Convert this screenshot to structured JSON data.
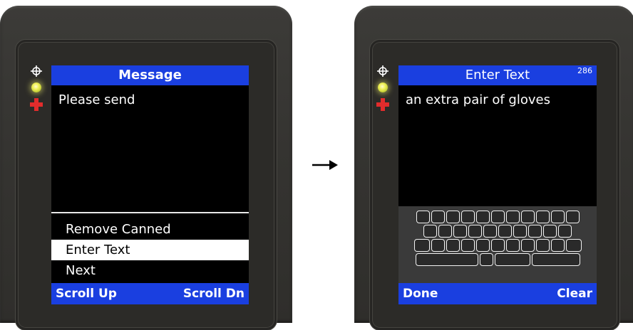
{
  "left_screen": {
    "title": "Message",
    "body_text": "Please send",
    "menu_items": [
      "Remove Canned",
      "Enter Text",
      "Next"
    ],
    "selected_index": 1,
    "softkeys": {
      "left": "Scroll Up",
      "right": "Scroll Dn"
    }
  },
  "right_screen": {
    "title": "Enter Text",
    "char_counter": "286",
    "body_text": "an extra pair of gloves",
    "softkeys": {
      "left": "Done",
      "right": "Clear"
    }
  },
  "transition": {
    "icon": "arrow-right-icon"
  },
  "colors": {
    "title_bar": "#1a3fe0",
    "screen_background": "#000000",
    "selected_item_background": "#ffffff",
    "led_indicator": "#f2f25a",
    "cross_indicator": "#e22c2c"
  }
}
